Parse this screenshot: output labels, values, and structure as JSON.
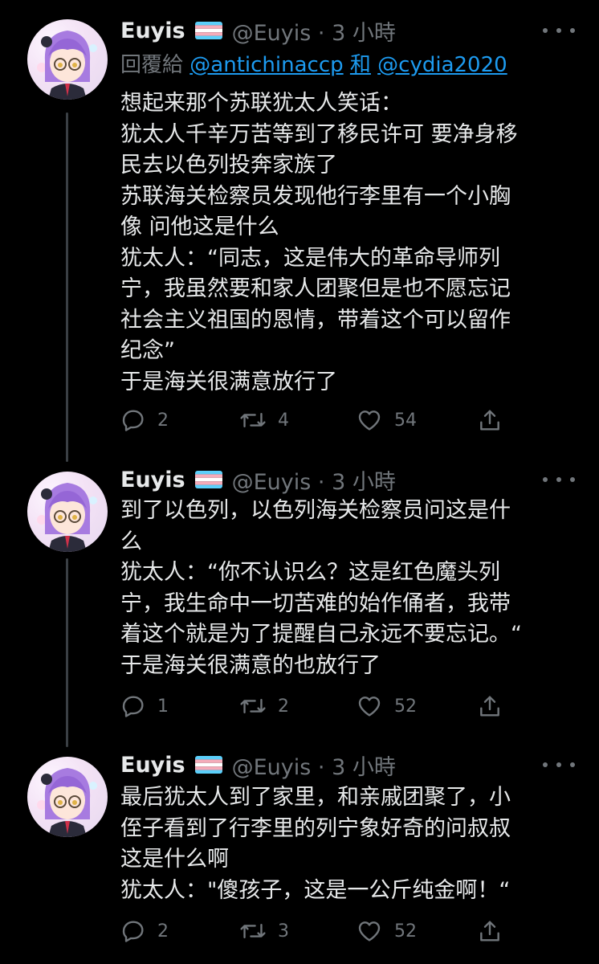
{
  "colors": {
    "background": "#000000",
    "text_primary": "#e7e9ea",
    "text_secondary": "#71767b",
    "link": "#1d9bf0",
    "thread_line": "#3a3f44"
  },
  "tweets": [
    {
      "display_name": "Euyis",
      "flag_icon": "transgender-flag-icon",
      "handle": "@Euyis",
      "separator": "·",
      "time": "3 小時",
      "reply_to": {
        "prefix": "回覆給",
        "mention1": "@antichinaccp",
        "joiner": "和",
        "mention2": "@cydia2020"
      },
      "lines": [
        "想起来那个苏联犹太人笑话：",
        "犹太人千辛万苦等到了移民许可 要净身移",
        "民去以色列投奔家族了",
        "苏联海关检察员发现他行李里有一个小胸",
        "像 问他这是什么",
        "犹太人：“同志，这是伟大的革命导师列",
        "宁，我虽然要和家人团聚但是也不愿忘记",
        "社会主义祖国的恩情，带着这个可以留作",
        "纪念”",
        "于是海关很满意放行了"
      ],
      "replies": "2",
      "retweets": "4",
      "likes": "54"
    },
    {
      "display_name": "Euyis",
      "flag_icon": "transgender-flag-icon",
      "handle": "@Euyis",
      "separator": "·",
      "time": "3 小時",
      "lines": [
        "到了以色列，以色列海关检察员问这是什",
        "么",
        "犹太人：“你不认识么？这是红色魔头列",
        "宁，我生命中一切苦难的始作俑者，我带",
        "着这个就是为了提醒自己永远不要忘记。“",
        "于是海关很满意的也放行了"
      ],
      "replies": "1",
      "retweets": "2",
      "likes": "52"
    },
    {
      "display_name": "Euyis",
      "flag_icon": "transgender-flag-icon",
      "handle": "@Euyis",
      "separator": "·",
      "time": "3 小時",
      "lines": [
        "最后犹太人到了家里，和亲戚团聚了，小",
        "侄子看到了行李里的列宁象好奇的问叔叔",
        "这是什么啊",
        "犹太人：\"傻孩子，这是一公斤纯金啊！“"
      ],
      "replies": "2",
      "retweets": "3",
      "likes": "52"
    }
  ]
}
